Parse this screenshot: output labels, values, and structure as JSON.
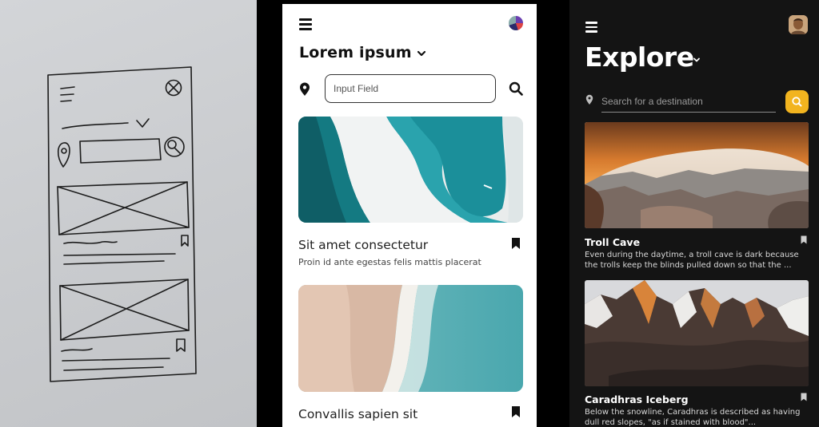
{
  "sketch": {
    "description_icons": [
      "menu-icon",
      "close-icon",
      "chevron-down-icon",
      "location-pin-icon",
      "search-icon",
      "bookmark-icon"
    ]
  },
  "light": {
    "title": "Lorem ipsum",
    "search_placeholder": "Input Field",
    "cards": [
      {
        "title": "Sit amet consectetur",
        "subtitle": "Proin id ante egestas felis mattis placerat"
      },
      {
        "title": "Convallis sapien sit"
      }
    ],
    "colors": {
      "background": "#ffffff",
      "text": "#111111"
    }
  },
  "dark": {
    "title": "Explore",
    "search_placeholder": "Search for a destination",
    "cards": [
      {
        "title": "Troll Cave",
        "description": "Even during the daytime, a troll cave is dark because the trolls keep the blinds pulled down so that the ..."
      },
      {
        "title": "Caradhras Iceberg",
        "description": "Below the snowline, Caradhras is described as having dull red slopes, \"as if stained with blood\"..."
      }
    ],
    "colors": {
      "background": "#141414",
      "accent": "#f2b41f",
      "text": "#ffffff"
    }
  }
}
